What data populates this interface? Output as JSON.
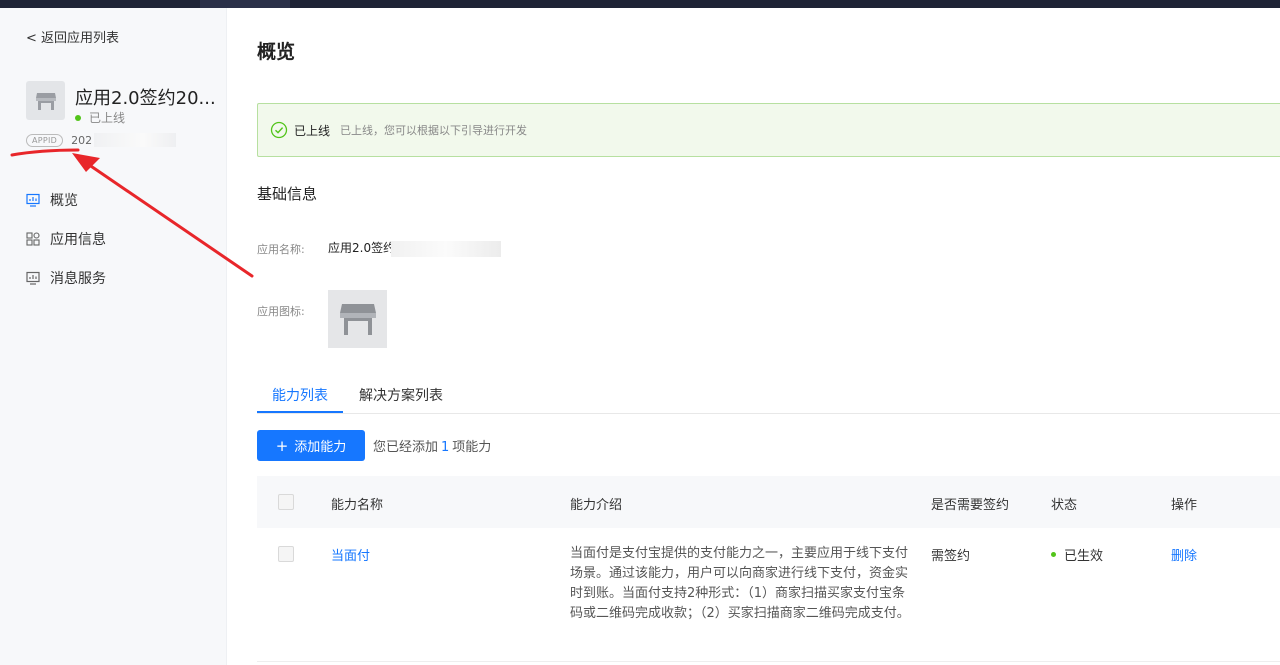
{
  "sidebar": {
    "back_label": "< 返回应用列表",
    "app_name": "应用2.0签约20...",
    "app_status": "已上线",
    "appid_badge": "APPID",
    "appid_prefix": "202",
    "nav": [
      {
        "label": "概览",
        "icon": "dashboard-icon"
      },
      {
        "label": "应用信息",
        "icon": "grid-icon"
      },
      {
        "label": "消息服务",
        "icon": "message-service-icon"
      }
    ]
  },
  "main": {
    "title": "概览",
    "alert": {
      "strong": "已上线",
      "desc": "已上线，您可以根据以下引导进行开发"
    },
    "basic_info": {
      "title": "基础信息",
      "name_label": "应用名称:",
      "name_value": "应用2.0签约",
      "icon_label": "应用图标:"
    },
    "tabs": [
      "能力列表",
      "解决方案列表"
    ],
    "add_button": "添加能力",
    "count_prefix": "您已经添加",
    "count_value": "1",
    "count_suffix": "项能力",
    "table": {
      "headers": [
        "能力名称",
        "能力介绍",
        "是否需要签约",
        "状态",
        "操作"
      ],
      "rows": [
        {
          "name": "当面付",
          "description": "当面付是支付宝提供的支付能力之一，主要应用于线下支付场景。通过该能力，用户可以向商家进行线下支付，资金实时到账。当面付支持2种形式：（1）商家扫描买家支付宝条码或二维码完成收款；（2）买家扫描商家二维码完成支付。",
          "signing": "需签约",
          "status": "已生效",
          "action": "删除"
        }
      ]
    }
  },
  "colors": {
    "primary": "#1677ff",
    "success": "#52c41a",
    "annotation": "#e8262a"
  }
}
